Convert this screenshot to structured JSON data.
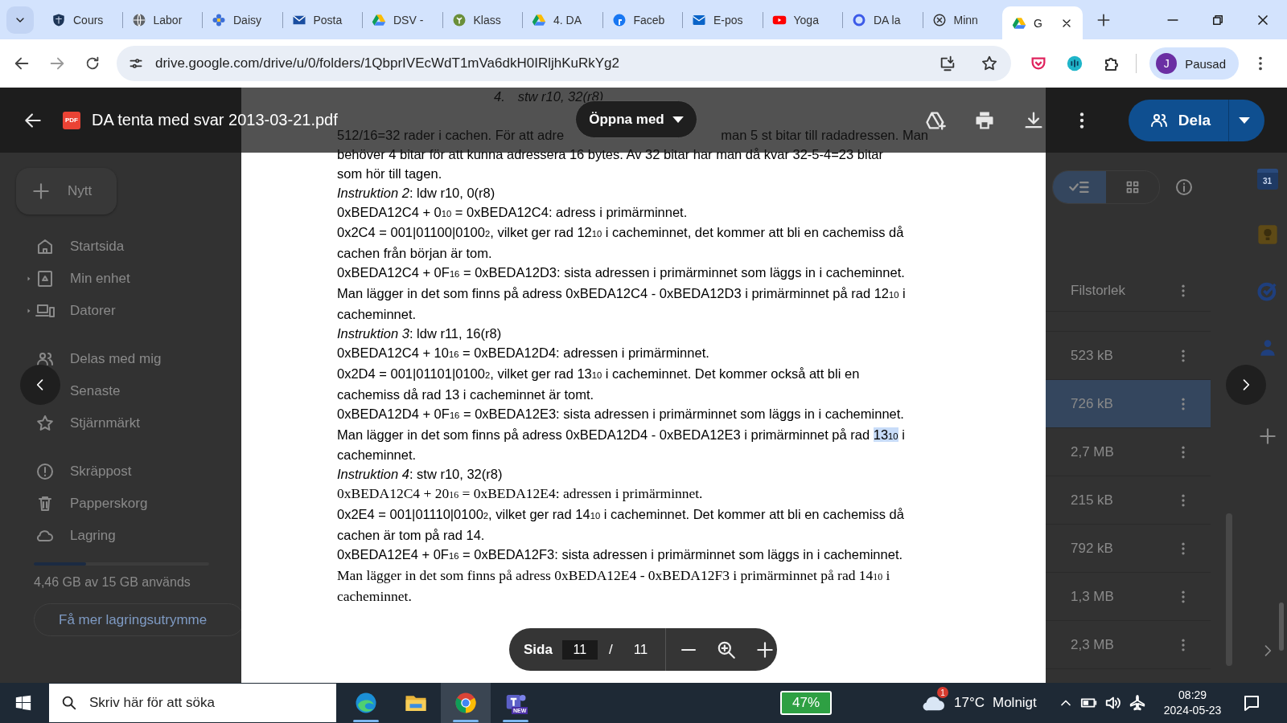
{
  "browser": {
    "tabs": [
      {
        "title": "Cours",
        "selected": false
      },
      {
        "title": "Labor",
        "selected": false
      },
      {
        "title": "Daisy",
        "selected": false
      },
      {
        "title": "Posta",
        "selected": false
      },
      {
        "title": "DSV -",
        "selected": false
      },
      {
        "title": "Klass",
        "selected": false
      },
      {
        "title": "4. DA",
        "selected": false
      },
      {
        "title": "Faceb",
        "selected": false
      },
      {
        "title": "E-pos",
        "selected": false
      },
      {
        "title": "Yoga",
        "selected": false
      },
      {
        "title": "DA la",
        "selected": false
      },
      {
        "title": "Minn",
        "selected": false
      },
      {
        "title": "G",
        "selected": true
      }
    ],
    "url": "drive.google.com/drive/u/0/folders/1QbprIVEcWdT1mVa6dkH0IRljhKuRkYg2",
    "profile": {
      "initial": "J",
      "status": "Pausad"
    }
  },
  "viewer": {
    "file_badge": "PDF",
    "title": "DA tenta med svar 2013-03-21.pdf",
    "open_with": "Öppna med",
    "share": "Dela",
    "page_label": "Sida",
    "page": "11",
    "separator": "/",
    "page_count": "11"
  },
  "drive": {
    "new_button": "Nytt",
    "nav_sections": [
      {
        "items": [
          {
            "label": "Startsida",
            "expandable": false
          },
          {
            "label": "Min enhet",
            "expandable": true
          },
          {
            "label": "Datorer",
            "expandable": true
          }
        ]
      },
      {
        "items": [
          {
            "label": "Delas med mig",
            "expandable": false
          },
          {
            "label": "Senaste",
            "expandable": false
          },
          {
            "label": "Stjärnmärkt",
            "expandable": false
          }
        ]
      },
      {
        "items": [
          {
            "label": "Skräppost",
            "expandable": false
          },
          {
            "label": "Papperskorg",
            "expandable": false
          },
          {
            "label": "Lagring",
            "expandable": false
          }
        ]
      }
    ],
    "storage": {
      "level": 0.3,
      "text": "4,46 GB av 15 GB används",
      "button": "Få mer lagringsutrymme"
    },
    "view_options": [
      {
        "selected": true
      },
      {
        "selected": false
      }
    ],
    "size_column": "Filstorlek",
    "rows": [
      {
        "size": "523 kB",
        "selected": false
      },
      {
        "size": "726 kB",
        "selected": true
      },
      {
        "size": "2,7 MB",
        "selected": false
      },
      {
        "size": "215 kB",
        "selected": false
      },
      {
        "size": "792 kB",
        "selected": false
      },
      {
        "size": "1,3 MB",
        "selected": false
      },
      {
        "size": "2,3 MB",
        "selected": false
      }
    ],
    "calendar_day": "31"
  },
  "document": {
    "lines": [
      {
        "kind": "list_item",
        "number": "4.",
        "text": "stw r10, 32(r8)"
      },
      {
        "kind": "covered",
        "parts": [
          "512/16=32 rader i cachen. För att adre",
          "man 5 st bitar till radadressen. Man"
        ]
      },
      {
        "kind": "sans",
        "text": "behöver 4 bitar för att kunna adressera 16 bytes. Av 32 bitar har man då kvar 32-5-4=23 bitar"
      },
      {
        "kind": "sans",
        "text": "som hör till tagen."
      },
      {
        "kind": "sans",
        "text": "*Instruktion 2*: ldw r10, 0(r8)"
      },
      {
        "kind": "sans",
        "text": "0xBEDA12C4 + 0$_{10}$ = 0xBEDA12C4: adress i primärminnet."
      },
      {
        "kind": "sans",
        "text": "0x2C4 = 001|01100|0100$_{2}$, vilket ger rad 12$_{10}$ i cacheminnet, det kommer att bli en cachemiss då"
      },
      {
        "kind": "sans",
        "text": "cachen från början är tom."
      },
      {
        "kind": "sans",
        "text": "0xBEDA12C4 + 0F$_{16}$ = 0xBEDA12D3: sista adressen i primärminnet som läggs in i cacheminnet."
      },
      {
        "kind": "sans",
        "text": "Man lägger in det som finns på adress 0xBEDA12C4 - 0xBEDA12D3 i primärminnet på rad 12$_{10}$ i"
      },
      {
        "kind": "sans",
        "text": "cacheminnet."
      },
      {
        "kind": "sans",
        "text": "*Instruktion 3*: ldw r11, 16(r8)"
      },
      {
        "kind": "sans",
        "text": "0xBEDA12C4 + 10$_{16}$ = 0xBEDA12D4: adressen i primärminnet."
      },
      {
        "kind": "sans",
        "text": "0x2D4 = 001|01101|0100$_{2}$, vilket ger rad 13$_{10}$ i cacheminnet. Det kommer också att bli en"
      },
      {
        "kind": "sans",
        "text": "cachemiss då rad 13 i cacheminnet är tomt."
      },
      {
        "kind": "sans",
        "text": "0xBEDA12D4 + 0F$_{16}$ = 0xBEDA12E3: sista adressen i primärminnet som läggs in i cacheminnet."
      },
      {
        "kind": "sans",
        "parts": [
          {
            "text": "Man lägger in det som finns på adress 0xBEDA12D4 - 0xBEDA12E3 i primärminnet på rad ",
            "highlighted": false
          },
          {
            "text": "13$_{10}$",
            "highlighted": true
          },
          {
            "text": " i",
            "highlighted": false
          }
        ]
      },
      {
        "kind": "sans",
        "text": "cacheminnet."
      },
      {
        "kind": "sans",
        "text": "*Instruktion 4*: stw r10, 32(r8)"
      },
      {
        "kind": "serif",
        "text": "0xBEDA12C4 + 20$_{16}$ = 0xBEDA12E4: adressen i primärminnet."
      },
      {
        "kind": "sans",
        "text": "0x2E4 = 001|01110|0100$_{2}$, vilket ger rad 14$_{10}$ i cacheminnet. Det kommer att bli en cachemiss då"
      },
      {
        "kind": "sans",
        "text": "cachen är tom på rad 14."
      },
      {
        "kind": "sans",
        "text": "0xBEDA12E4 + 0F$_{16}$ = 0xBEDA12F3: sista adressen i primärminnet som läggs in i cacheminnet."
      },
      {
        "kind": "serif",
        "text": "Man lägger in det som finns på adress 0xBEDA12E4 - 0xBEDA12F3 i primärminnet på rad 14$_{10}$ i"
      },
      {
        "kind": "serif",
        "text": "cacheminnet."
      }
    ]
  },
  "taskbar": {
    "search_placeholder": "Skriv här för att söka",
    "apps": [
      {
        "selected": false,
        "running": true
      },
      {
        "selected": false,
        "running": false
      },
      {
        "selected": true,
        "running": true
      },
      {
        "selected": false,
        "running": true,
        "badge": "NEW"
      }
    ],
    "battery": "47%",
    "weather_badge": "1",
    "temperature": "17°C",
    "weather": "Molnigt",
    "time": "08:29",
    "date": "2024-05-23"
  }
}
